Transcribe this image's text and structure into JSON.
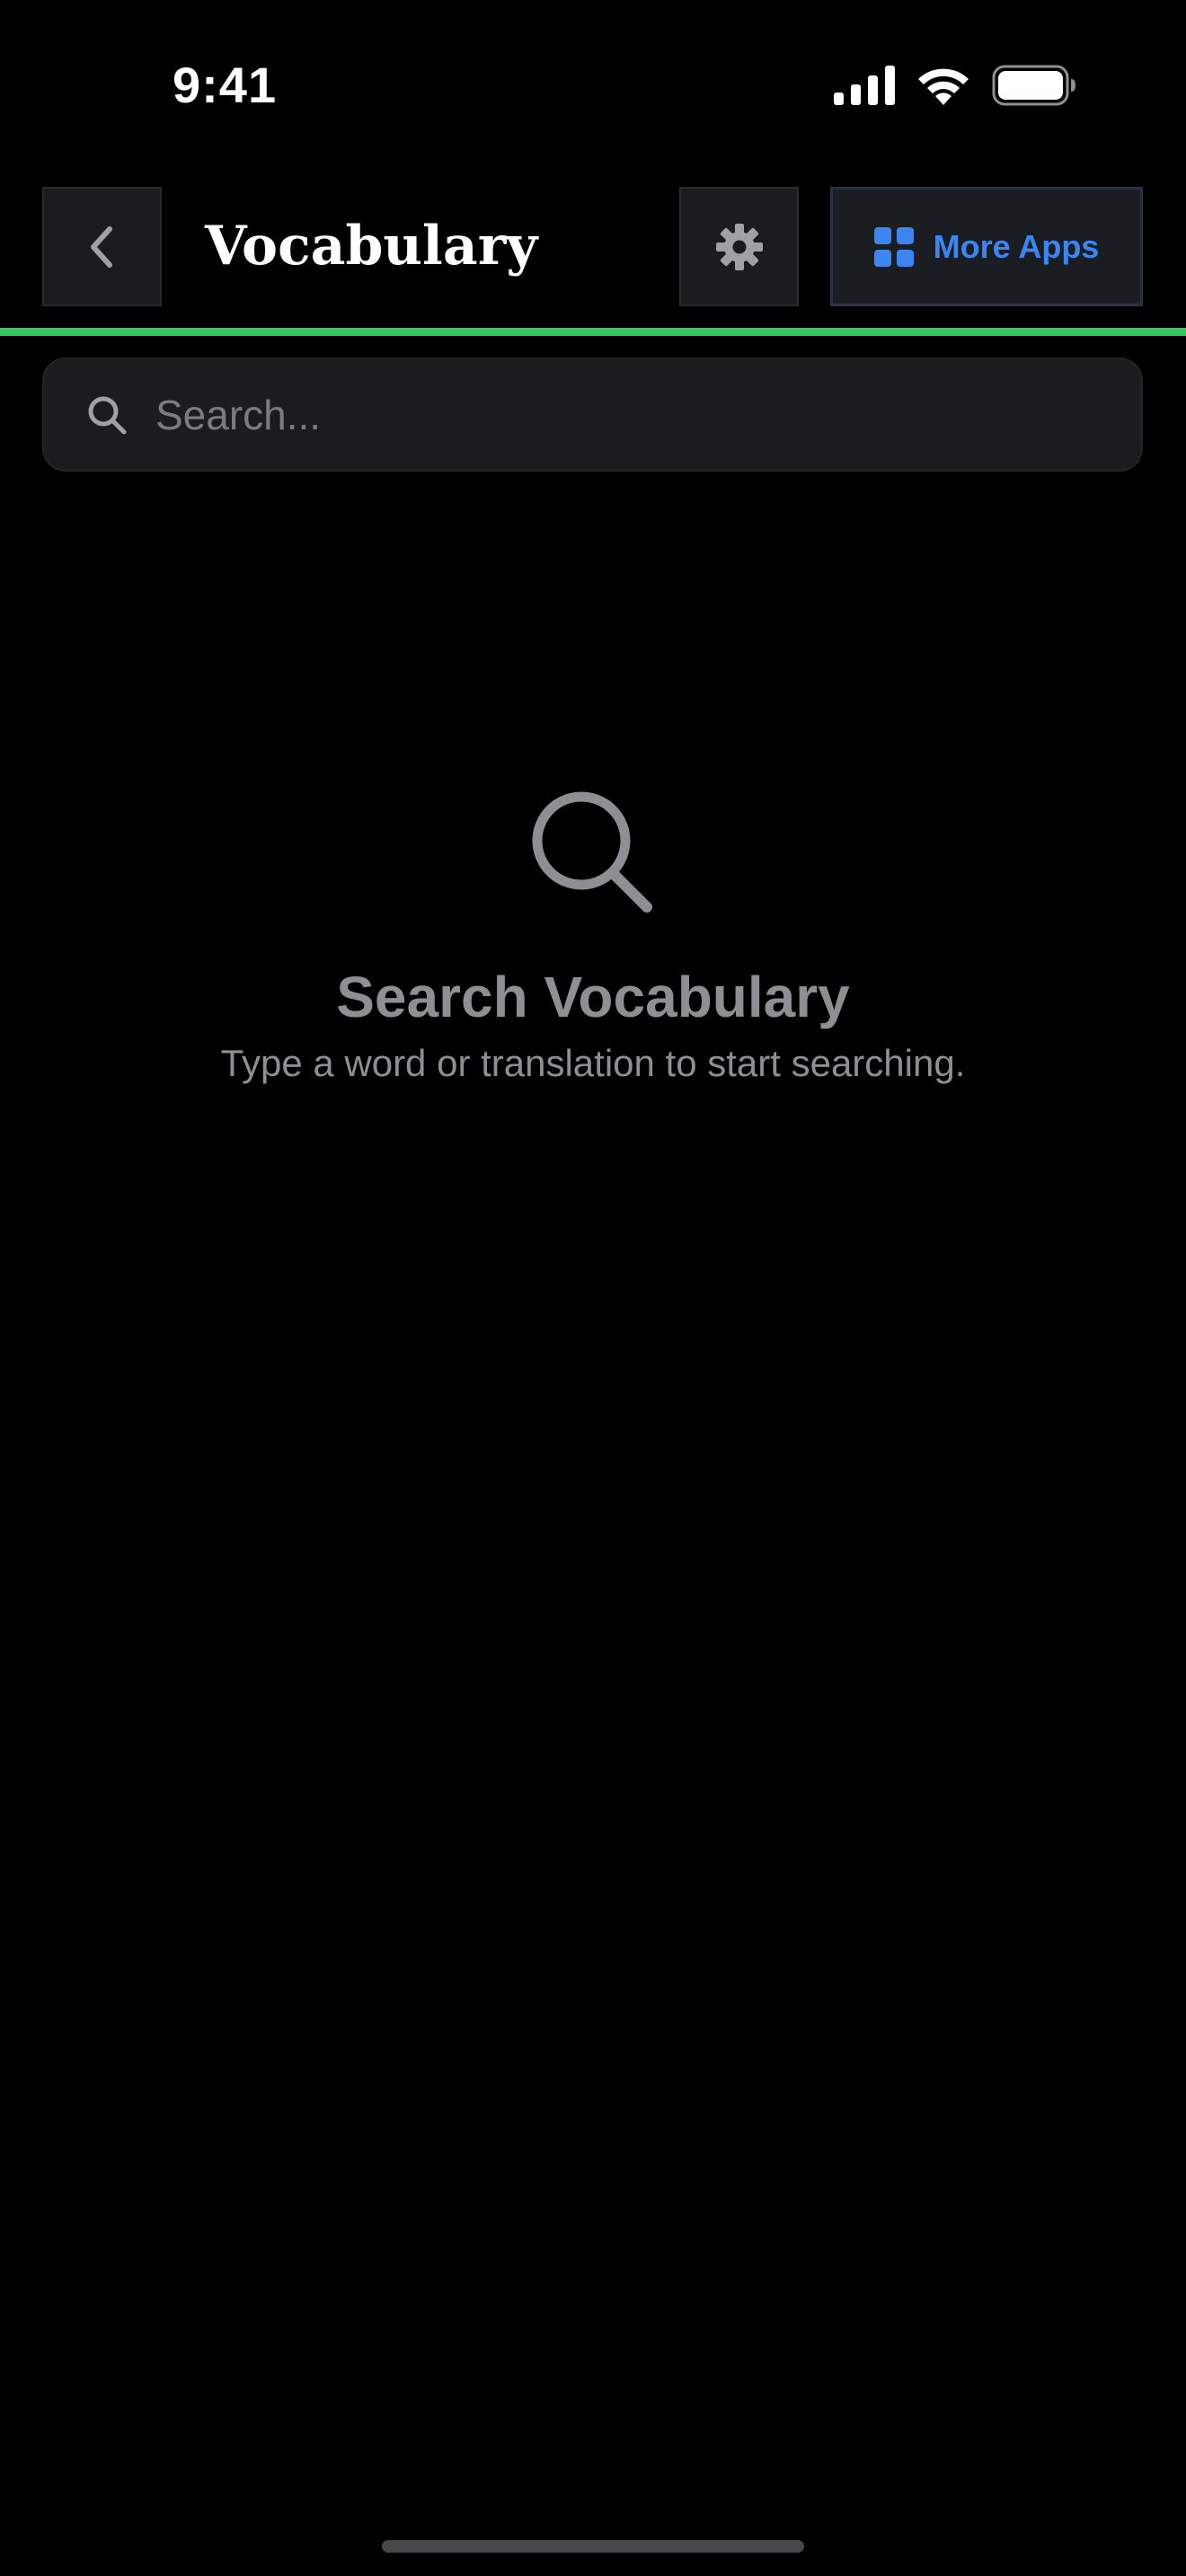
{
  "status_bar": {
    "time": "9:41",
    "icons": [
      "signal-icon",
      "wifi-icon",
      "battery-icon"
    ]
  },
  "header": {
    "back_icon": "chevron-left-icon",
    "title": "Vocabulary",
    "settings_icon": "gear-icon",
    "more_apps_icon": "grid-icon",
    "more_apps_label": "More Apps"
  },
  "search": {
    "icon": "search-icon",
    "placeholder": "Search...",
    "value": ""
  },
  "empty_state": {
    "icon": "magnifier-icon",
    "title": "Search Vocabulary",
    "subtitle": "Type a word or translation to start searching."
  },
  "colors": {
    "background": "#000000",
    "accent_green": "#34c759",
    "accent_blue": "#3d85f0",
    "muted_text": "#8e8e93",
    "surface": "#1c1c1e"
  }
}
